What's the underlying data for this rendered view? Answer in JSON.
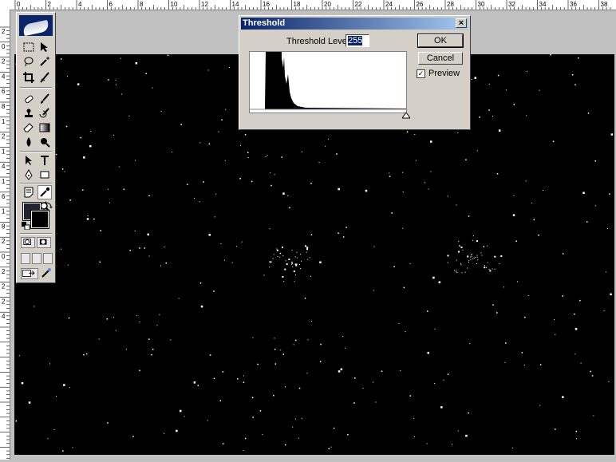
{
  "ruler": {
    "top_ticks": [
      "0",
      "2",
      "4",
      "6",
      "8",
      "10",
      "12",
      "14",
      "16",
      "18",
      "20",
      "22",
      "24",
      "26",
      "28",
      "30",
      "32",
      "34",
      "36",
      "38"
    ],
    "left_ticks": [
      "2",
      "0",
      "2",
      "4",
      "6",
      "8",
      "1",
      "2",
      "1",
      "4",
      "1",
      "6",
      "1",
      "8",
      "2",
      "0",
      "2",
      "2",
      "2",
      "4"
    ]
  },
  "toolbox": {
    "tools": [
      "marquee-icon",
      "move-icon",
      "lasso-icon",
      "magic-wand-icon",
      "crop-icon",
      "slice-icon",
      "healing-brush-icon",
      "brush-icon",
      "clone-stamp-icon",
      "history-brush-icon",
      "eraser-icon",
      "gradient-icon",
      "blur-icon",
      "dodge-icon",
      "path-selection-icon",
      "type-icon",
      "pen-icon",
      "shape-icon",
      "notes-icon",
      "eyedropper-icon",
      "hand-icon",
      "zoom-icon"
    ],
    "selected_tool": "eyedropper-icon",
    "foreground_color": "#1e2430",
    "background_color": "#000000"
  },
  "dialog": {
    "title": "Threshold",
    "close_label": "×",
    "level_label": "Threshold Level:",
    "level_value": "255",
    "ok_label": "OK",
    "cancel_label": "Cancel",
    "preview_label": "Preview",
    "preview_checked": true,
    "check_mark": "✓"
  }
}
